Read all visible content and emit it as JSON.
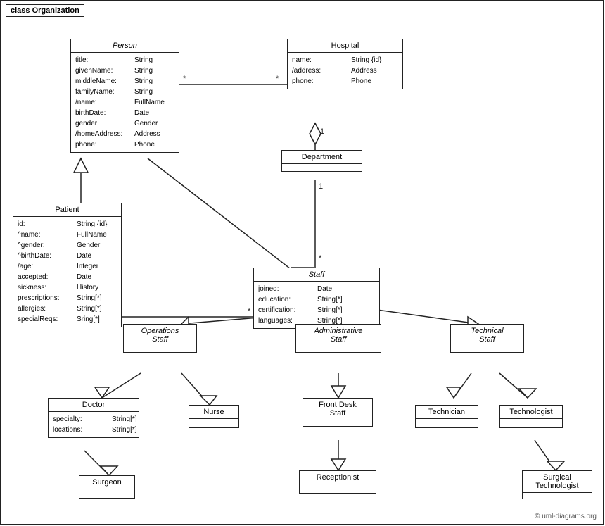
{
  "diagram": {
    "frame_label": "class Organization",
    "copyright": "© uml-diagrams.org",
    "classes": {
      "person": {
        "title": "Person",
        "italic": true,
        "attrs": [
          {
            "name": "title:",
            "type": "String"
          },
          {
            "name": "givenName:",
            "type": "String"
          },
          {
            "name": "middleName:",
            "type": "String"
          },
          {
            "name": "familyName:",
            "type": "String"
          },
          {
            "name": "/name:",
            "type": "FullName"
          },
          {
            "name": "birthDate:",
            "type": "Date"
          },
          {
            "name": "gender:",
            "type": "Gender"
          },
          {
            "name": "/homeAddress:",
            "type": "Address"
          },
          {
            "name": "phone:",
            "type": "Phone"
          }
        ]
      },
      "hospital": {
        "title": "Hospital",
        "italic": false,
        "attrs": [
          {
            "name": "name:",
            "type": "String {id}"
          },
          {
            "name": "/address:",
            "type": "Address"
          },
          {
            "name": "phone:",
            "type": "Phone"
          }
        ]
      },
      "patient": {
        "title": "Patient",
        "italic": false,
        "attrs": [
          {
            "name": "id:",
            "type": "String {id}"
          },
          {
            "name": "^name:",
            "type": "FullName"
          },
          {
            "name": "^gender:",
            "type": "Gender"
          },
          {
            "name": "^birthDate:",
            "type": "Date"
          },
          {
            "name": "/age:",
            "type": "Integer"
          },
          {
            "name": "accepted:",
            "type": "Date"
          },
          {
            "name": "sickness:",
            "type": "History"
          },
          {
            "name": "prescriptions:",
            "type": "String[*]"
          },
          {
            "name": "allergies:",
            "type": "String[*]"
          },
          {
            "name": "specialReqs:",
            "type": "Sring[*]"
          }
        ]
      },
      "department": {
        "title": "Department",
        "italic": false,
        "attrs": []
      },
      "staff": {
        "title": "Staff",
        "italic": true,
        "attrs": [
          {
            "name": "joined:",
            "type": "Date"
          },
          {
            "name": "education:",
            "type": "String[*]"
          },
          {
            "name": "certification:",
            "type": "String[*]"
          },
          {
            "name": "languages:",
            "type": "String[*]"
          }
        ]
      },
      "operations_staff": {
        "title": "Operations\nStaff",
        "italic": true
      },
      "administrative_staff": {
        "title": "Administrative\nStaff",
        "italic": true
      },
      "technical_staff": {
        "title": "Technical\nStaff",
        "italic": true
      },
      "doctor": {
        "title": "Doctor",
        "italic": false,
        "attrs": [
          {
            "name": "specialty:",
            "type": "String[*]"
          },
          {
            "name": "locations:",
            "type": "String[*]"
          }
        ]
      },
      "nurse": {
        "title": "Nurse",
        "italic": false,
        "attrs": []
      },
      "front_desk_staff": {
        "title": "Front Desk\nStaff",
        "italic": false,
        "attrs": []
      },
      "technician": {
        "title": "Technician",
        "italic": false,
        "attrs": []
      },
      "technologist": {
        "title": "Technologist",
        "italic": false,
        "attrs": []
      },
      "surgeon": {
        "title": "Surgeon",
        "italic": false,
        "attrs": []
      },
      "receptionist": {
        "title": "Receptionist",
        "italic": false,
        "attrs": []
      },
      "surgical_technologist": {
        "title": "Surgical\nTechnologist",
        "italic": false,
        "attrs": []
      }
    }
  }
}
